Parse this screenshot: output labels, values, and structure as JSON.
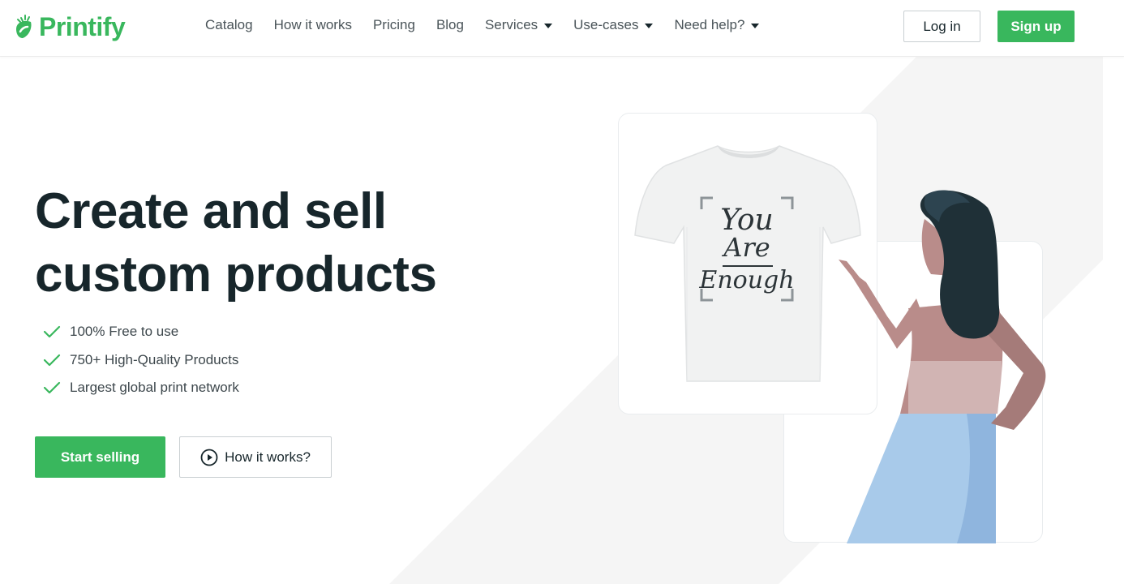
{
  "header": {
    "logo_text": "Printify",
    "logo_icon": "printify-leaf-icon",
    "nav": [
      {
        "label": "Catalog",
        "dropdown": false
      },
      {
        "label": "How it works",
        "dropdown": false
      },
      {
        "label": "Pricing",
        "dropdown": false
      },
      {
        "label": "Blog",
        "dropdown": false
      },
      {
        "label": "Services",
        "dropdown": true
      },
      {
        "label": "Use-cases",
        "dropdown": true
      },
      {
        "label": "Need help?",
        "dropdown": true
      }
    ],
    "login_label": "Log in",
    "signup_label": "Sign up"
  },
  "hero": {
    "title_line1": "Create and sell",
    "title_line2": "custom products",
    "features": [
      "100% Free to use",
      "750+ High-Quality Products",
      "Largest global print network"
    ],
    "start_label": "Start selling",
    "how_label": "How it works?"
  },
  "illustration": {
    "shirt_text_line1": "You",
    "shirt_text_line2": "Are",
    "shirt_text_line3": "Enough"
  },
  "colors": {
    "brand_green": "#39b75d",
    "dark_text": "#17262b",
    "background_band": "#f5f5f5"
  }
}
